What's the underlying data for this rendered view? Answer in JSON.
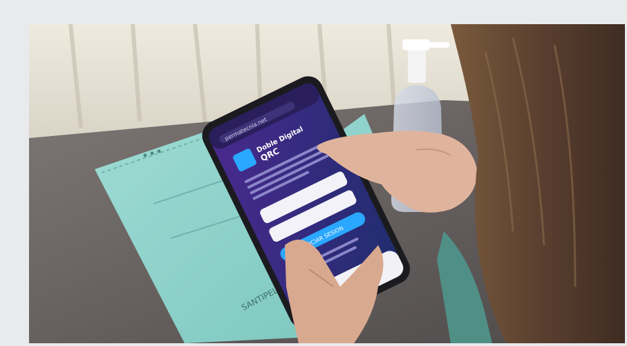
{
  "photo": {
    "case_brand": "SANTIPELLA",
    "phone_screen": {
      "url": "permatecnia.net",
      "app_name": "Doble Digital",
      "app_subtitle": "QRC",
      "login_button": "INICIAR SESION"
    }
  },
  "colors": {
    "page_background": "#e9eaec",
    "case_teal": "#8fd3cc",
    "screen_purple": "#3b2e8f",
    "accent_blue": "#2aa7ff"
  }
}
